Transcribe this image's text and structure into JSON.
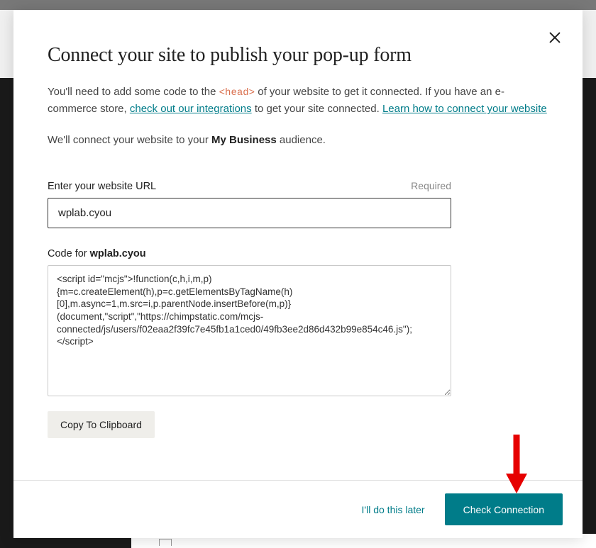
{
  "modal": {
    "title": "Connect your site to publish your pop-up form",
    "intro_part1": "You'll need to add some code to the ",
    "head_tag": "<head>",
    "intro_part2": " of your website to get it connected. If you have an e-commerce store, ",
    "integrations_link": "check out our integrations",
    "intro_part3": " to get your site connected. ",
    "learn_link": "Learn how to connect your website",
    "connect_line_part1": "We'll connect your website to your ",
    "business_name": "My Business",
    "connect_line_part2": " audience.",
    "url_label": "Enter your website URL",
    "required_text": "Required",
    "url_value": "wplab.cyou",
    "code_label_prefix": "Code for ",
    "code_label_domain": "wplab.cyou",
    "code_value": "<script id=\"mcjs\">!function(c,h,i,m,p){m=c.createElement(h),p=c.getElementsByTagName(h)[0],m.async=1,m.src=i,p.parentNode.insertBefore(m,p)}(document,\"script\",\"https://chimpstatic.com/mcjs-connected/js/users/f02eaa2f39fc7e45fb1a1ced0/49fb3ee2d86d432b99e854c46.js\");</script>",
    "copy_button": "Copy To Clipboard",
    "later_link": "I'll do this later",
    "primary_button": "Check Connection"
  }
}
